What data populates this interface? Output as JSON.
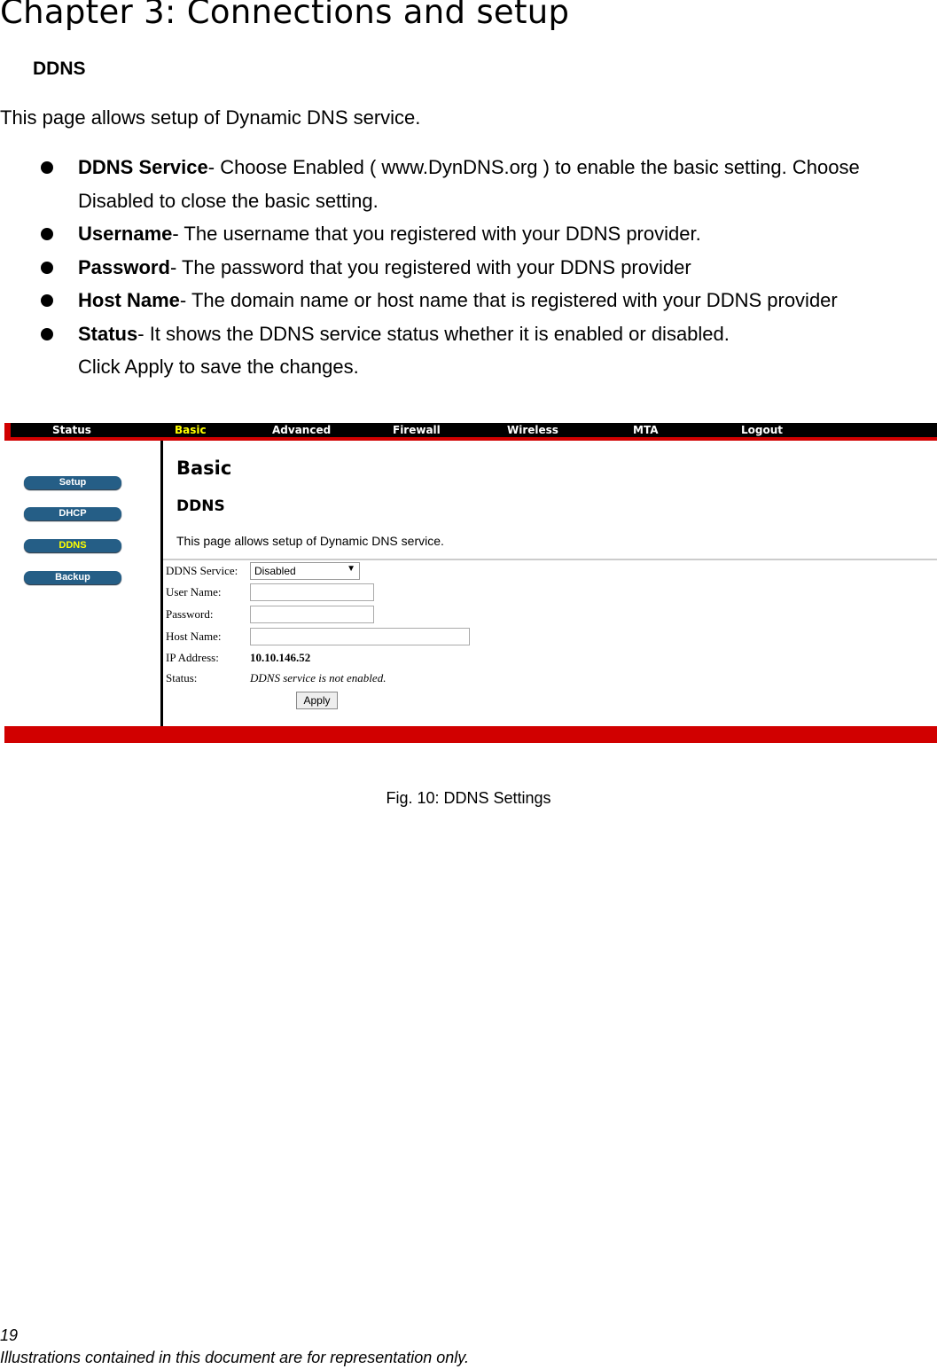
{
  "doc": {
    "title": "Chapter 3: Connections and setup",
    "section": "DDNS",
    "intro": "This page allows setup of Dynamic DNS service.",
    "bullets": [
      {
        "term": "DDNS Service",
        "text": "- Choose Enabled ( www.DynDNS.org ) to enable the basic setting. Choose",
        "cont": "Disabled to close the basic setting."
      },
      {
        "term": "Username",
        "text": "- The username that you registered with your DDNS provider."
      },
      {
        "term": "Password",
        "text": "- The password that you registered with your DDNS provider"
      },
      {
        "term": "Host Name",
        "text": "- The domain name or host name that is registered with your DDNS provider"
      },
      {
        "term": "Status",
        "text": "- It shows the DDNS service status whether it is enabled or disabled."
      }
    ],
    "apply_note": "Click Apply to save the changes.",
    "caption": "Fig. 10: DDNS Settings",
    "page_number": "19",
    "disclaimer": "Illustrations contained in this document are for representation only."
  },
  "screenshot": {
    "nav": [
      "Status",
      "Basic",
      "Advanced",
      "Firewall",
      "Wireless",
      "MTA",
      "Logout"
    ],
    "active_nav": "Basic",
    "sidebar": [
      "Setup",
      "DHCP",
      "DDNS",
      "Backup"
    ],
    "active_sidebar": "DDNS",
    "heading": "Basic",
    "subheading": "DDNS",
    "description": "This page allows setup of Dynamic DNS service.",
    "form": {
      "ddns_service_label": "DDNS Service:",
      "ddns_service_value": "Disabled",
      "username_label": "User Name:",
      "username_value": "",
      "password_label": "Password:",
      "password_value": "",
      "hostname_label": "Host Name:",
      "hostname_value": "",
      "ip_label": "IP Address:",
      "ip_value": "10.10.146.52",
      "status_label": "Status:",
      "status_value": "DDNS service is not enabled.",
      "apply": "Apply"
    },
    "colors": {
      "nav_bg": "#000000",
      "accent_red": "#d10000",
      "active_text": "#ffff00",
      "sidebar_button": "#255e86"
    }
  }
}
